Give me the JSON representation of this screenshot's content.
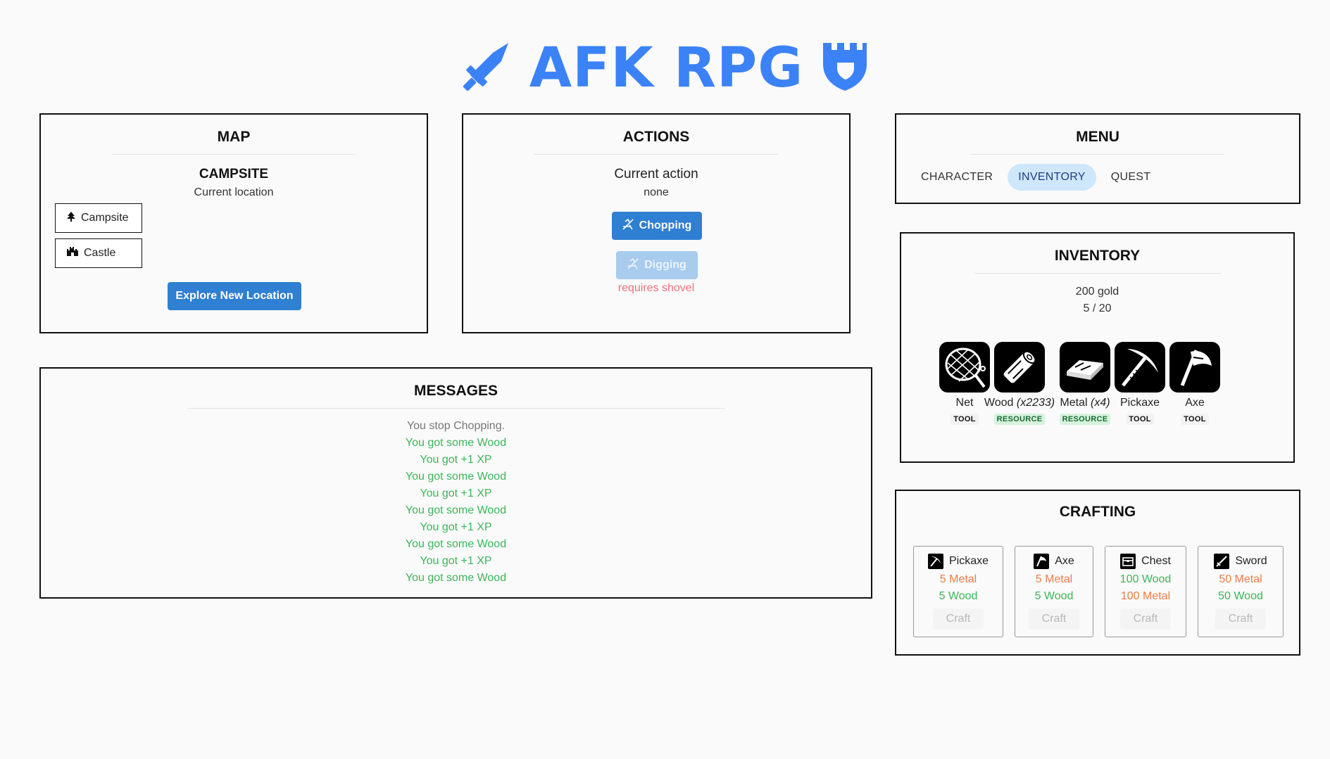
{
  "title": {
    "text": "AFK RPG",
    "color": "#3b82f6",
    "left_icon": "sword-icon",
    "right_icon": "castle-shield-icon"
  },
  "map": {
    "heading": "MAP",
    "location_name": "CAMPSITE",
    "location_caption": "Current location",
    "locations": [
      {
        "label": "Campsite",
        "icon": "tree-icon"
      },
      {
        "label": "Castle",
        "icon": "castle-icon"
      }
    ],
    "explore_label": "Explore New Location"
  },
  "actions": {
    "heading": "ACTIONS",
    "current_label": "Current action",
    "current_value": "none",
    "chopping_label": "Chopping",
    "digging_label": "Digging",
    "digging_requirement": "requires shovel"
  },
  "menu": {
    "heading": "MENU",
    "tabs": [
      "CHARACTER",
      "INVENTORY",
      "QUEST"
    ],
    "active_tab": "INVENTORY"
  },
  "inventory": {
    "heading": "INVENTORY",
    "gold": "200 gold",
    "capacity": "5 / 20",
    "items": [
      {
        "name": "Net",
        "qty": "",
        "type": "TOOL",
        "icon": "net-icon"
      },
      {
        "name": "Wood",
        "qty": "(x2233)",
        "type": "RESOURCE",
        "icon": "log-icon"
      },
      {
        "name": "Metal",
        "qty": "(x4)",
        "type": "RESOURCE",
        "icon": "metal-ingot-icon"
      },
      {
        "name": "Pickaxe",
        "qty": "",
        "type": "TOOL",
        "icon": "pickaxe-icon"
      },
      {
        "name": "Axe",
        "qty": "",
        "type": "TOOL",
        "icon": "axe-icon"
      }
    ]
  },
  "messages": {
    "heading": "MESSAGES",
    "lines": [
      {
        "text": "You stop Chopping.",
        "kind": "neutral"
      },
      {
        "text": "You got some Wood",
        "kind": "gain"
      },
      {
        "text": "You got +1 XP",
        "kind": "gain"
      },
      {
        "text": "You got some Wood",
        "kind": "gain"
      },
      {
        "text": "You got +1 XP",
        "kind": "gain"
      },
      {
        "text": "You got some Wood",
        "kind": "gain"
      },
      {
        "text": "You got +1 XP",
        "kind": "gain"
      },
      {
        "text": "You got some Wood",
        "kind": "gain"
      },
      {
        "text": "You got +1 XP",
        "kind": "gain"
      },
      {
        "text": "You got some Wood",
        "kind": "gain"
      }
    ],
    "colors": {
      "neutral": "#777777",
      "gain": "#3cb55a"
    }
  },
  "crafting": {
    "heading": "CRAFTING",
    "craft_label": "Craft",
    "recipes": [
      {
        "name": "Pickaxe",
        "icon": "pickaxe-icon",
        "costs": [
          {
            "text": "5 Metal",
            "status": "missing"
          },
          {
            "text": "5 Wood",
            "status": "have"
          }
        ]
      },
      {
        "name": "Axe",
        "icon": "axe-icon",
        "costs": [
          {
            "text": "5 Metal",
            "status": "missing"
          },
          {
            "text": "5 Wood",
            "status": "have"
          }
        ]
      },
      {
        "name": "Chest",
        "icon": "chest-icon",
        "costs": [
          {
            "text": "100 Wood",
            "status": "have"
          },
          {
            "text": "100 Metal",
            "status": "missing"
          }
        ]
      },
      {
        "name": "Sword",
        "icon": "sword-icon",
        "costs": [
          {
            "text": "50 Metal",
            "status": "missing"
          },
          {
            "text": "50 Wood",
            "status": "have"
          }
        ]
      }
    ]
  },
  "colors": {
    "accent": "#2f7fd2",
    "missing": "#f07a48",
    "have": "#3cb55a",
    "requirement": "#f0707a"
  }
}
